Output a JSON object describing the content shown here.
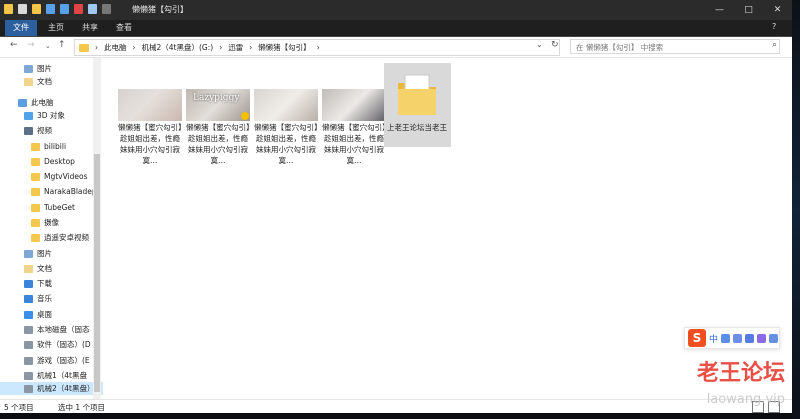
{
  "window": {
    "title": "懒懒猪【勾引】"
  },
  "ribbon": {
    "tabs": [
      "文件",
      "主页",
      "共享",
      "查看"
    ]
  },
  "address": {
    "crumbs": [
      "此电脑",
      "机械2（4t黑盘）(G:)",
      "迅雷",
      "懒懒猪【勾引】"
    ],
    "search_placeholder": "在 懒懒猪【勾引】 中搜索"
  },
  "sidebar": {
    "items": [
      {
        "label": "图片",
        "icon": "pictures-icon"
      },
      {
        "label": "文档",
        "icon": "documents-icon"
      },
      {
        "label": "此电脑",
        "icon": "computer-icon"
      },
      {
        "label": "3D 对象",
        "icon": "3d-objects-icon"
      },
      {
        "label": "视频",
        "icon": "videos-icon"
      },
      {
        "label": "bilibili",
        "icon": "folder-icon"
      },
      {
        "label": "Desktop",
        "icon": "folder-icon"
      },
      {
        "label": "MgtvVideos",
        "icon": "folder-icon"
      },
      {
        "label": "NarakaBladep",
        "icon": "folder-icon"
      },
      {
        "label": "TubeGet",
        "icon": "folder-icon"
      },
      {
        "label": "摄像",
        "icon": "folder-icon"
      },
      {
        "label": "逍遥安卓视频",
        "icon": "folder-icon"
      },
      {
        "label": "图片",
        "icon": "pictures-icon"
      },
      {
        "label": "文档",
        "icon": "documents-icon"
      },
      {
        "label": "下载",
        "icon": "downloads-icon"
      },
      {
        "label": "音乐",
        "icon": "music-icon"
      },
      {
        "label": "桌面",
        "icon": "desktop-icon"
      },
      {
        "label": "本地磁盘（固态",
        "icon": "drive-icon"
      },
      {
        "label": "软件（固态）(D",
        "icon": "drive-icon"
      },
      {
        "label": "游戏（固态）(E",
        "icon": "drive-icon"
      },
      {
        "label": "机械1（4t黑盘",
        "icon": "drive-icon"
      },
      {
        "label": "机械2（4t黑盘）",
        "icon": "drive-icon"
      }
    ]
  },
  "files": [
    {
      "caption": "懒懒猪【蜜穴勾引】趁姐姐出差，性瘾妹妹用小穴勾引寂寞…",
      "type": "video"
    },
    {
      "caption": "懒懒猪【蜜穴勾引】趁姐姐出差，性瘾妹妹用小穴勾引寂寞…",
      "type": "video",
      "overlay": "Lazypiggy"
    },
    {
      "caption": "懒懒猪【蜜穴勾引】趁姐姐出差，性瘾妹妹用小穴勾引寂寞…",
      "type": "video"
    },
    {
      "caption": "懒懒猪【蜜穴勾引】趁姐姐出差，性瘾妹妹用小穴勾引寂寞…",
      "type": "video"
    },
    {
      "caption": "上老王论坛当老王",
      "type": "folder"
    }
  ],
  "status": {
    "item_count": "5 个项目",
    "selected": "选中 1 个项目"
  },
  "ime": {
    "logo": "S",
    "mode": "中"
  },
  "watermark": {
    "main": "老王论坛",
    "sub": "laowang.vip"
  },
  "colors": {
    "title_bar": "#2b2b2b",
    "file_tab": "#2c5f9e",
    "folder": "#f4c84c",
    "selection": "#cce8ff",
    "watermark": "#e6291d"
  }
}
